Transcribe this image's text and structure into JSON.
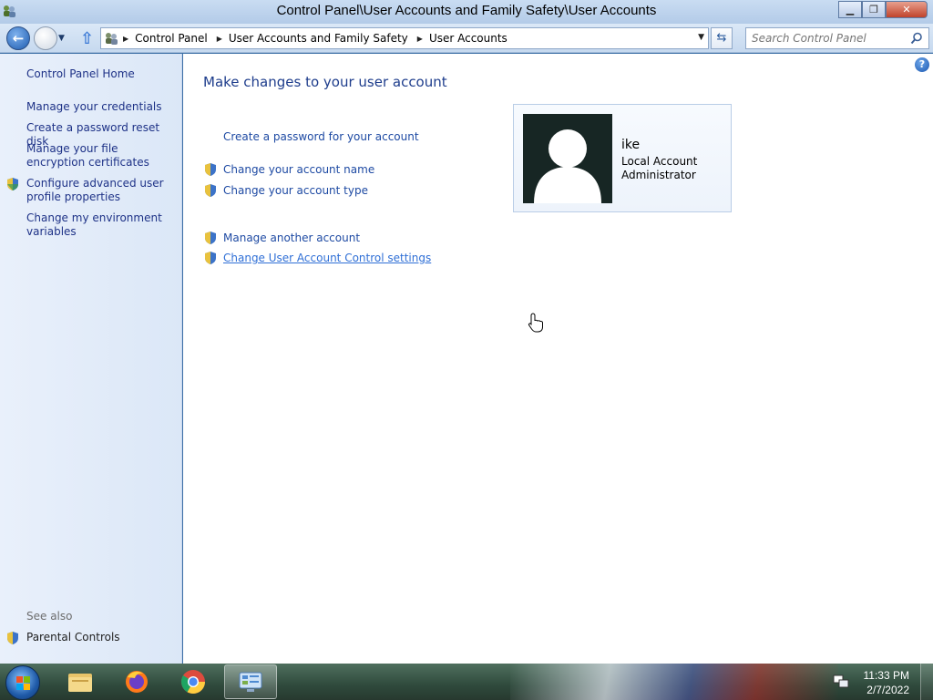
{
  "window": {
    "title": "Control Panel\\User Accounts and Family Safety\\User Accounts",
    "minimize_label": "▁",
    "maximize_label": "❐",
    "close_label": "✕"
  },
  "nav": {
    "back_icon": "back-arrow-icon",
    "forward_icon": "forward-arrow-icon",
    "breadcrumbs": [
      "Control Panel",
      "User Accounts and Family Safety",
      "User Accounts"
    ],
    "search_placeholder": "Search Control Panel"
  },
  "sidebar": {
    "home": "Control Panel Home",
    "links": [
      {
        "label": "Manage your credentials",
        "shield": false
      },
      {
        "label": "Create a password reset disk",
        "shield": false
      },
      {
        "label": "Manage your file encryption certificates",
        "shield": false
      },
      {
        "label": "Configure advanced user profile properties",
        "shield": true
      },
      {
        "label": "Change my environment variables",
        "shield": false
      }
    ],
    "see_also": "See also",
    "parental_controls": "Parental Controls"
  },
  "main": {
    "heading": "Make changes to your user account",
    "tasks": [
      "Create a password for your account",
      "Change your account name",
      "Change your account type",
      "Manage another account",
      "Change User Account Control settings"
    ],
    "help_label": "?"
  },
  "account": {
    "name": "ike",
    "type": "Local Account",
    "role": "Administrator"
  },
  "taskbar": {
    "apps": [
      "windows-explorer",
      "firefox",
      "chrome",
      "control-panel"
    ],
    "active_app": "control-panel",
    "time": "11:33 PM",
    "date": "2/7/2022"
  },
  "colors": {
    "link": "#1e4aa3",
    "heading": "#1e3d8c",
    "sidebar_link": "#1e3287"
  }
}
